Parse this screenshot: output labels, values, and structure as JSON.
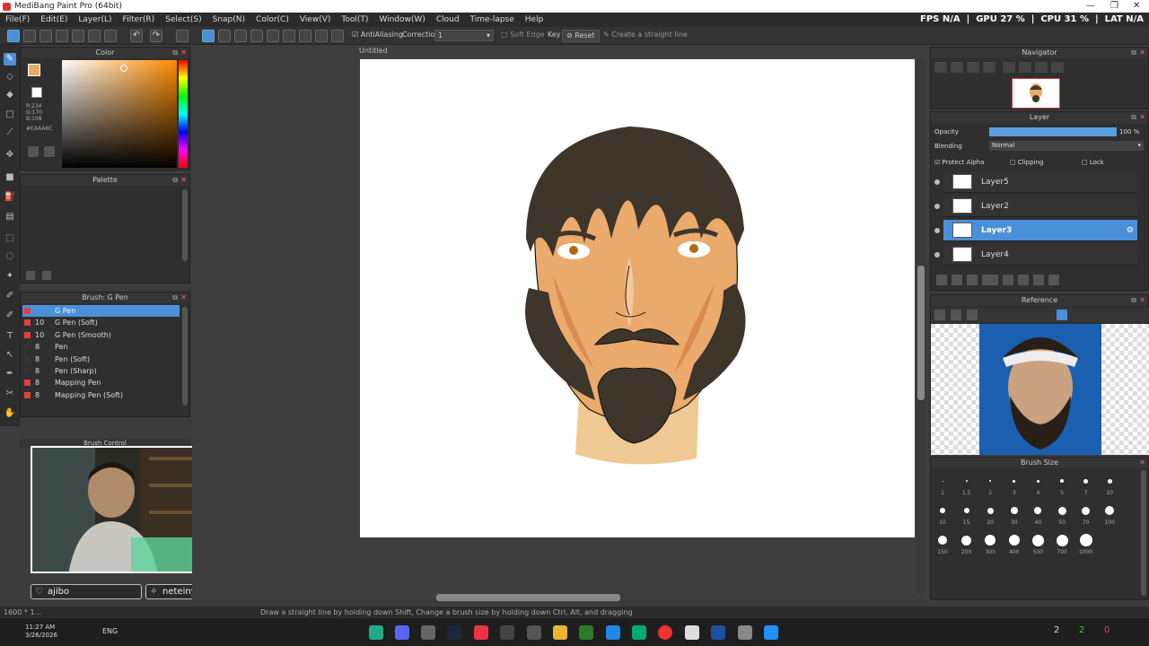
{
  "window": {
    "title": "MediBang Paint Pro (64bit)",
    "document": "Untitled"
  },
  "menu": [
    "File(F)",
    "Edit(E)",
    "Layer(L)",
    "Filter(R)",
    "Select(S)",
    "Snap(N)",
    "Color(C)",
    "View(V)",
    "Tool(T)",
    "Window(W)",
    "Cloud",
    "Time-lapse",
    "Help"
  ],
  "perf": {
    "fps": "FPS N/A",
    "gpu": "GPU 27 %",
    "cpu": "CPU 31 %",
    "lat": "LAT N/A"
  },
  "toolbar": {
    "antialiasing": "AntiAliasing",
    "correction_label": "Correction",
    "correction_value": "1",
    "soft_edge": "Soft Edge",
    "key": "Key",
    "reset": "Reset",
    "straight": "Create a straight line"
  },
  "color_panel": {
    "title": "Color",
    "r": "R:234",
    "g": "G:170",
    "b": "B:108",
    "hex": "#EAAA6C",
    "main": "#EAAA6C",
    "secondary": "#ffffff"
  },
  "palette_panel": {
    "title": "Palette"
  },
  "brush_panel": {
    "title": "Brush: G Pen",
    "items": [
      {
        "size": "",
        "name": "G Pen",
        "color": "#e04040",
        "selected": true
      },
      {
        "size": "10",
        "name": "G Pen (Soft)",
        "color": "#e04040"
      },
      {
        "size": "10",
        "name": "G Pen (Smooth)",
        "color": "#e04040"
      },
      {
        "size": "8",
        "name": "Pen",
        "color": "#333333"
      },
      {
        "size": "8",
        "name": "Pen (Soft)",
        "color": "#333333"
      },
      {
        "size": "8",
        "name": "Pen (Sharp)",
        "color": "#333333"
      },
      {
        "size": "8",
        "name": "Mapping Pen",
        "color": "#e04040"
      },
      {
        "size": "8",
        "name": "Mapping Pen (Soft)",
        "color": "#e04040"
      }
    ]
  },
  "brush_control": {
    "title": "Brush Control"
  },
  "chat_tags": [
    {
      "text": "ajibo"
    },
    {
      "text": "neteinyahu"
    }
  ],
  "navigator": {
    "title": "Navigator"
  },
  "layer_panel": {
    "title": "Layer",
    "opacity_label": "Opacity",
    "opacity_value": "100 %",
    "blending_label": "Blending",
    "blending_value": "Normal",
    "protect_alpha": "Protect Alpha",
    "clipping": "Clipping",
    "lock": "Lock",
    "layers": [
      {
        "name": "Layer5",
        "selected": false
      },
      {
        "name": "Layer2",
        "selected": false
      },
      {
        "name": "Layer3",
        "selected": true
      },
      {
        "name": "Layer4",
        "selected": false
      }
    ]
  },
  "reference": {
    "title": "Reference"
  },
  "brush_size": {
    "title": "Brush Size",
    "labels": [
      "1",
      "1.5",
      "2",
      "3",
      "4",
      "5",
      "7",
      "10",
      "10",
      "15",
      "20",
      "30",
      "40",
      "50",
      "70",
      "100",
      "150",
      "200",
      "300",
      "400",
      "500",
      "700",
      "1000"
    ]
  },
  "status": {
    "text": "Draw a straight line by holding down Shift, Change a brush size by holding down Ctrl, Alt, and dragging",
    "dims": "1600 * 1..."
  },
  "taskbar": {
    "time": "11:27 AM",
    "date": "3/26/2026",
    "lang": "ENG",
    "badges": [
      "2",
      "2",
      "0"
    ]
  }
}
